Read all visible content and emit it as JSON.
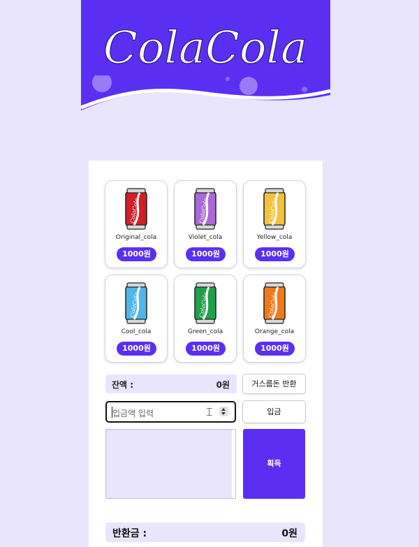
{
  "brand": {
    "logo_text": "ColaCola",
    "brand_color": "#5b2ff2",
    "background": "#e8e5fc"
  },
  "products": [
    {
      "name": "Original_cola",
      "price": "1000원",
      "color": "#d11f26"
    },
    {
      "name": "Violet_cola",
      "price": "1000원",
      "color": "#a96ad8"
    },
    {
      "name": "Yellow_cola",
      "price": "1000원",
      "color": "#f2c23a"
    },
    {
      "name": "Cool_cola",
      "price": "1000원",
      "color": "#4fb6ea"
    },
    {
      "name": "Green_cola",
      "price": "1000원",
      "color": "#1fa14a"
    },
    {
      "name": "Orange_cola",
      "price": "1000원",
      "color": "#f07a19"
    }
  ],
  "balance": {
    "label": "잔액 :",
    "value": "0원"
  },
  "change_button": "거스름돈 반환",
  "deposit": {
    "placeholder": "입금액 입력",
    "button": "입금"
  },
  "get_button": "획득",
  "refund": {
    "label": "반환금 :",
    "value": "0원"
  }
}
